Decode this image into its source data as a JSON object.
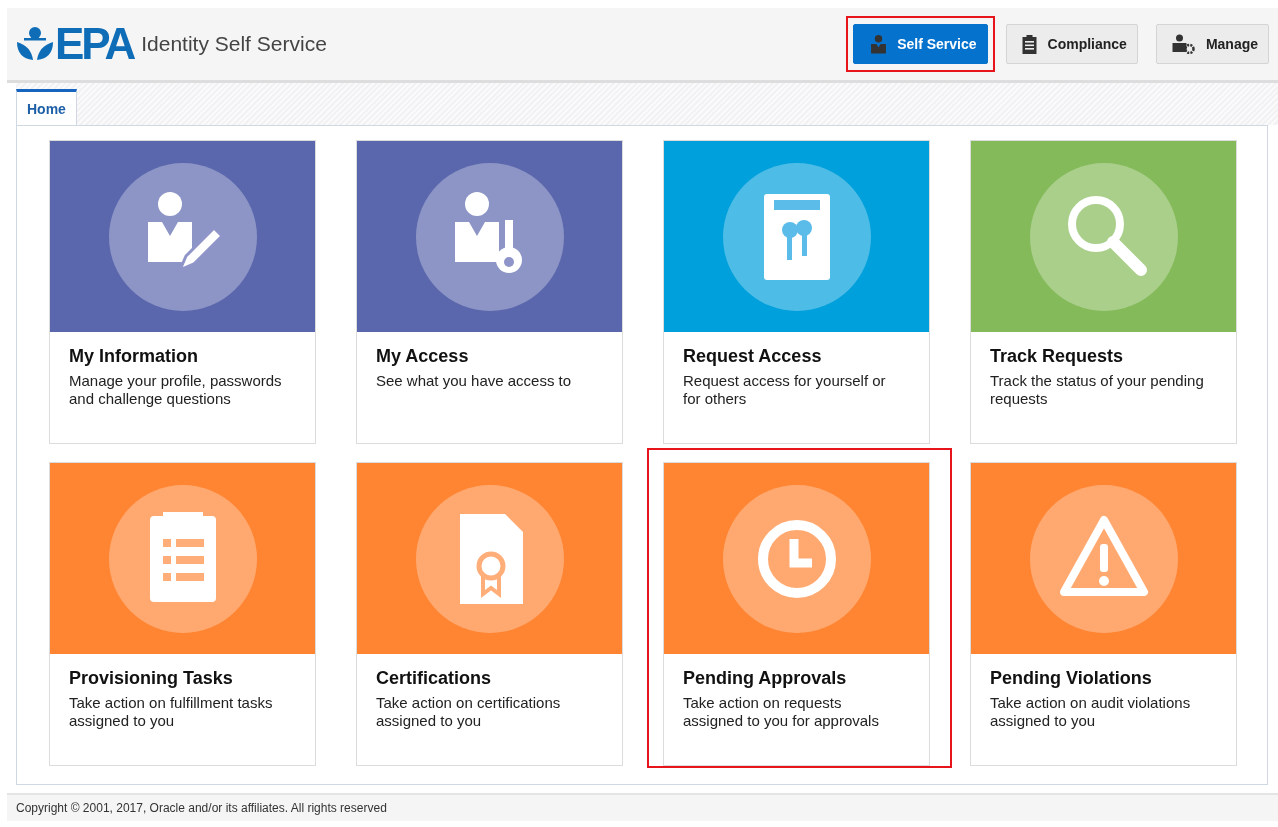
{
  "header": {
    "logo_text": "EPA",
    "title": "Identity Self Service"
  },
  "nav_buttons": [
    {
      "label": "Self Service",
      "selected": true,
      "highlighted": true
    },
    {
      "label": "Compliance",
      "selected": false,
      "highlighted": false
    },
    {
      "label": "Manage",
      "selected": false,
      "highlighted": false
    }
  ],
  "tabs": [
    {
      "label": "Home",
      "selected": true
    }
  ],
  "tiles": [
    {
      "title": "My Information",
      "description": "Manage your profile, passwords and challenge questions",
      "color": "#5b67ad",
      "highlighted": false
    },
    {
      "title": "My Access",
      "description": "See what you have access to",
      "color": "#5b67ad",
      "highlighted": false
    },
    {
      "title": "Request Access",
      "description": "Request access for yourself or for others",
      "color": "#00a0dc",
      "highlighted": false
    },
    {
      "title": "Track Requests",
      "description": "Track the status of your pending requests",
      "color": "#85ba5a",
      "highlighted": false
    },
    {
      "title": "Provisioning Tasks",
      "description": "Take action on fulfillment tasks assigned to you",
      "color": "#ff8533",
      "highlighted": false
    },
    {
      "title": "Certifications",
      "description": "Take action on certifications assigned to you",
      "color": "#ff8533",
      "highlighted": false
    },
    {
      "title": "Pending Approvals",
      "description": "Take action on requests assigned to you for approvals",
      "color": "#ff8533",
      "highlighted": true
    },
    {
      "title": "Pending Violations",
      "description": "Take action on audit violations assigned to you",
      "color": "#ff8533",
      "highlighted": false
    }
  ],
  "footer": {
    "copyright": "Copyright © 2001, 2017, Oracle and/or its affiliates. All rights reserved"
  }
}
